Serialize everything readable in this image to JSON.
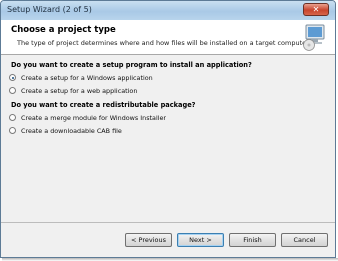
{
  "window": {
    "title": "Setup Wizard (2 of 5)",
    "close_glyph": "✕"
  },
  "header": {
    "title": "Choose a project type",
    "subtitle": "The type of project determines where and how files will be installed on a target computer.",
    "icon": "setup-computer-icon"
  },
  "sections": [
    {
      "question": "Do you want to create a setup program to install an application?",
      "options": [
        {
          "label": "Create a setup for a Windows application",
          "checked": true
        },
        {
          "label": "Create a setup for a web application",
          "checked": false
        }
      ]
    },
    {
      "question": "Do you want to create a redistributable package?",
      "options": [
        {
          "label": "Create a merge module for Windows Installer",
          "checked": false
        },
        {
          "label": "Create a downloadable CAB file",
          "checked": false
        }
      ]
    }
  ],
  "buttons": {
    "previous": "< Previous",
    "next": "Next >",
    "finish": "Finish",
    "cancel": "Cancel"
  },
  "colors": {
    "titlebar": "#a9c9e6",
    "close_button": "#c8452e",
    "radio_dot": "#1c5180"
  }
}
